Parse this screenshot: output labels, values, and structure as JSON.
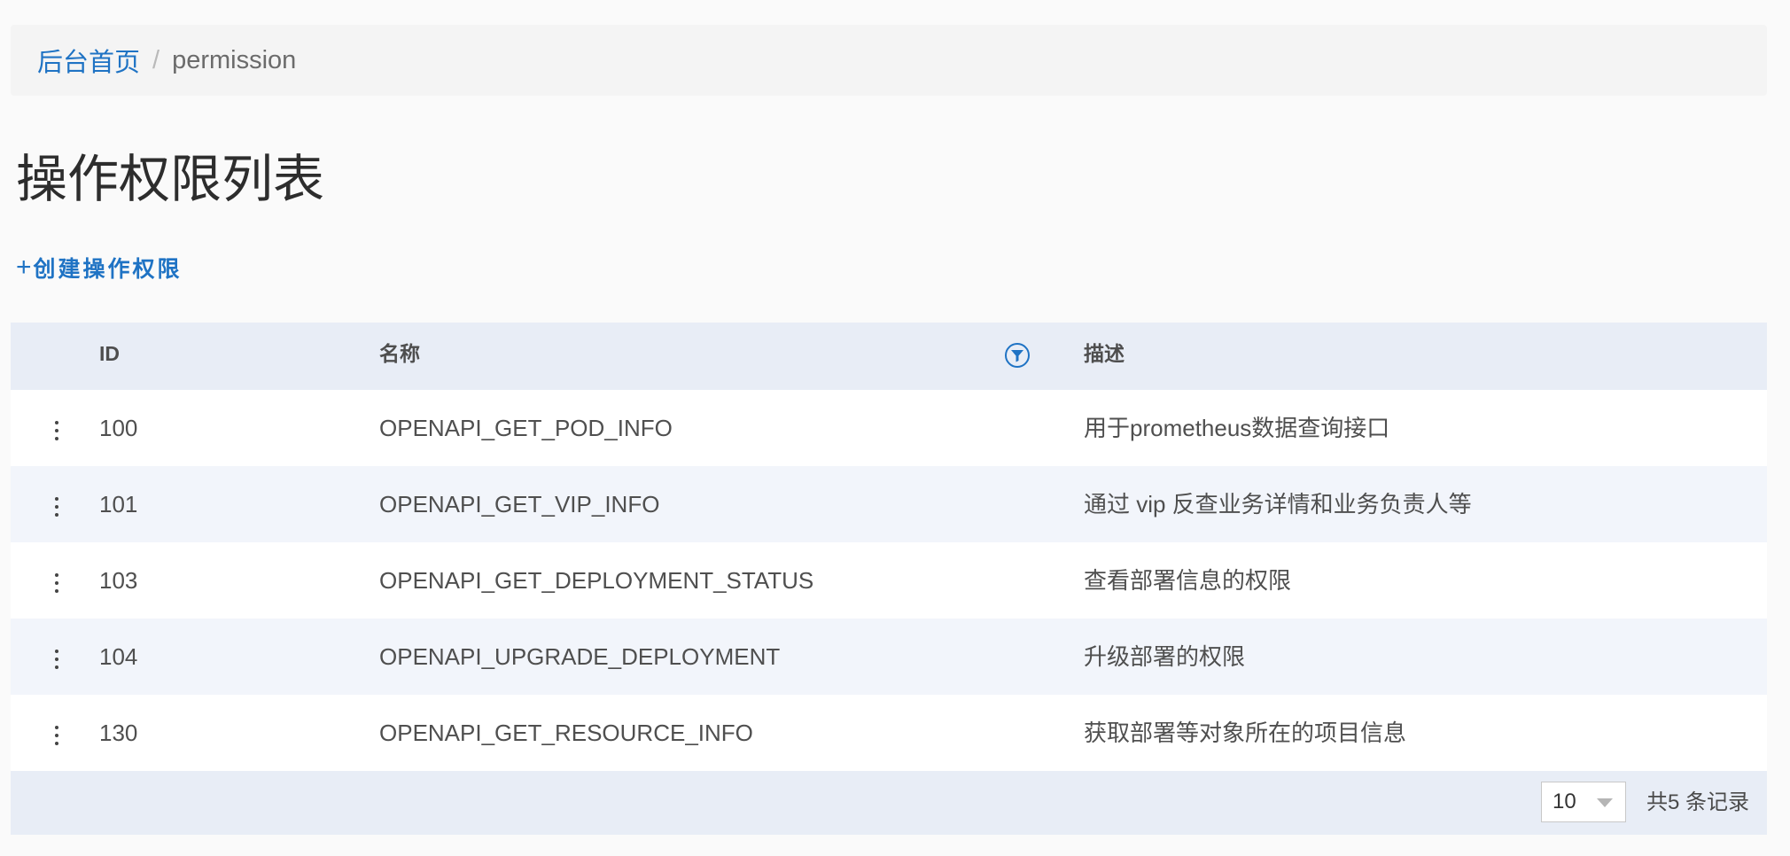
{
  "breadcrumb": {
    "home": "后台首页",
    "separator": "/",
    "current": "permission"
  },
  "page_title": "操作权限列表",
  "create_action": {
    "icon": "plus-icon",
    "plus": "+",
    "label": "创建操作权限"
  },
  "table": {
    "columns": {
      "id": "ID",
      "name": "名称",
      "description": "描述"
    },
    "filter_icon": "filter-icon",
    "rows": [
      {
        "id": "100",
        "name": "OPENAPI_GET_POD_INFO",
        "description": "用于prometheus数据查询接口"
      },
      {
        "id": "101",
        "name": "OPENAPI_GET_VIP_INFO",
        "description": "通过 vip 反查业务详情和业务负责人等"
      },
      {
        "id": "103",
        "name": "OPENAPI_GET_DEPLOYMENT_STATUS",
        "description": "查看部署信息的权限"
      },
      {
        "id": "104",
        "name": "OPENAPI_UPGRADE_DEPLOYMENT",
        "description": "升级部署的权限"
      },
      {
        "id": "130",
        "name": "OPENAPI_GET_RESOURCE_INFO",
        "description": "获取部署等对象所在的项目信息"
      }
    ]
  },
  "pagination": {
    "page_size": "10",
    "total_text": "共5 条记录"
  },
  "colors": {
    "link": "#1f73c4",
    "header_bg": "#e8edf6",
    "row_alt_bg": "#f2f5fb",
    "page_bg": "#fafafa"
  }
}
